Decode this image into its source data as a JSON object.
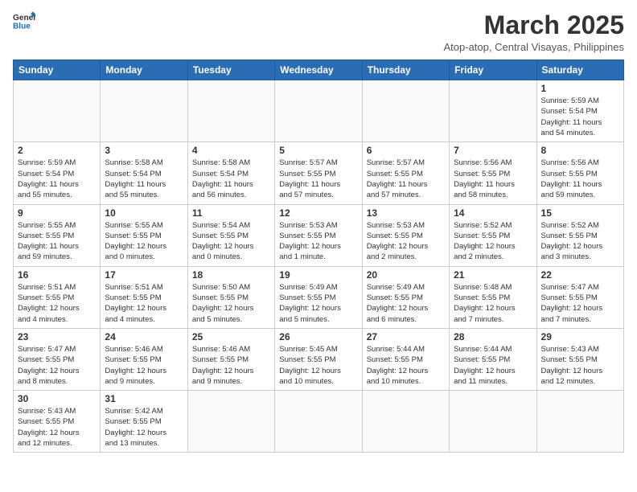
{
  "logo": {
    "line1": "General",
    "line2": "Blue"
  },
  "title": "March 2025",
  "subtitle": "Atop-atop, Central Visayas, Philippines",
  "weekdays": [
    "Sunday",
    "Monday",
    "Tuesday",
    "Wednesday",
    "Thursday",
    "Friday",
    "Saturday"
  ],
  "weeks": [
    [
      {
        "day": "",
        "info": ""
      },
      {
        "day": "",
        "info": ""
      },
      {
        "day": "",
        "info": ""
      },
      {
        "day": "",
        "info": ""
      },
      {
        "day": "",
        "info": ""
      },
      {
        "day": "",
        "info": ""
      },
      {
        "day": "1",
        "info": "Sunrise: 5:59 AM\nSunset: 5:54 PM\nDaylight: 11 hours\nand 54 minutes."
      }
    ],
    [
      {
        "day": "2",
        "info": "Sunrise: 5:59 AM\nSunset: 5:54 PM\nDaylight: 11 hours\nand 55 minutes."
      },
      {
        "day": "3",
        "info": "Sunrise: 5:58 AM\nSunset: 5:54 PM\nDaylight: 11 hours\nand 55 minutes."
      },
      {
        "day": "4",
        "info": "Sunrise: 5:58 AM\nSunset: 5:54 PM\nDaylight: 11 hours\nand 56 minutes."
      },
      {
        "day": "5",
        "info": "Sunrise: 5:57 AM\nSunset: 5:55 PM\nDaylight: 11 hours\nand 57 minutes."
      },
      {
        "day": "6",
        "info": "Sunrise: 5:57 AM\nSunset: 5:55 PM\nDaylight: 11 hours\nand 57 minutes."
      },
      {
        "day": "7",
        "info": "Sunrise: 5:56 AM\nSunset: 5:55 PM\nDaylight: 11 hours\nand 58 minutes."
      },
      {
        "day": "8",
        "info": "Sunrise: 5:56 AM\nSunset: 5:55 PM\nDaylight: 11 hours\nand 59 minutes."
      }
    ],
    [
      {
        "day": "9",
        "info": "Sunrise: 5:55 AM\nSunset: 5:55 PM\nDaylight: 11 hours\nand 59 minutes."
      },
      {
        "day": "10",
        "info": "Sunrise: 5:55 AM\nSunset: 5:55 PM\nDaylight: 12 hours\nand 0 minutes."
      },
      {
        "day": "11",
        "info": "Sunrise: 5:54 AM\nSunset: 5:55 PM\nDaylight: 12 hours\nand 0 minutes."
      },
      {
        "day": "12",
        "info": "Sunrise: 5:53 AM\nSunset: 5:55 PM\nDaylight: 12 hours\nand 1 minute."
      },
      {
        "day": "13",
        "info": "Sunrise: 5:53 AM\nSunset: 5:55 PM\nDaylight: 12 hours\nand 2 minutes."
      },
      {
        "day": "14",
        "info": "Sunrise: 5:52 AM\nSunset: 5:55 PM\nDaylight: 12 hours\nand 2 minutes."
      },
      {
        "day": "15",
        "info": "Sunrise: 5:52 AM\nSunset: 5:55 PM\nDaylight: 12 hours\nand 3 minutes."
      }
    ],
    [
      {
        "day": "16",
        "info": "Sunrise: 5:51 AM\nSunset: 5:55 PM\nDaylight: 12 hours\nand 4 minutes."
      },
      {
        "day": "17",
        "info": "Sunrise: 5:51 AM\nSunset: 5:55 PM\nDaylight: 12 hours\nand 4 minutes."
      },
      {
        "day": "18",
        "info": "Sunrise: 5:50 AM\nSunset: 5:55 PM\nDaylight: 12 hours\nand 5 minutes."
      },
      {
        "day": "19",
        "info": "Sunrise: 5:49 AM\nSunset: 5:55 PM\nDaylight: 12 hours\nand 5 minutes."
      },
      {
        "day": "20",
        "info": "Sunrise: 5:49 AM\nSunset: 5:55 PM\nDaylight: 12 hours\nand 6 minutes."
      },
      {
        "day": "21",
        "info": "Sunrise: 5:48 AM\nSunset: 5:55 PM\nDaylight: 12 hours\nand 7 minutes."
      },
      {
        "day": "22",
        "info": "Sunrise: 5:47 AM\nSunset: 5:55 PM\nDaylight: 12 hours\nand 7 minutes."
      }
    ],
    [
      {
        "day": "23",
        "info": "Sunrise: 5:47 AM\nSunset: 5:55 PM\nDaylight: 12 hours\nand 8 minutes."
      },
      {
        "day": "24",
        "info": "Sunrise: 5:46 AM\nSunset: 5:55 PM\nDaylight: 12 hours\nand 9 minutes."
      },
      {
        "day": "25",
        "info": "Sunrise: 5:46 AM\nSunset: 5:55 PM\nDaylight: 12 hours\nand 9 minutes."
      },
      {
        "day": "26",
        "info": "Sunrise: 5:45 AM\nSunset: 5:55 PM\nDaylight: 12 hours\nand 10 minutes."
      },
      {
        "day": "27",
        "info": "Sunrise: 5:44 AM\nSunset: 5:55 PM\nDaylight: 12 hours\nand 10 minutes."
      },
      {
        "day": "28",
        "info": "Sunrise: 5:44 AM\nSunset: 5:55 PM\nDaylight: 12 hours\nand 11 minutes."
      },
      {
        "day": "29",
        "info": "Sunrise: 5:43 AM\nSunset: 5:55 PM\nDaylight: 12 hours\nand 12 minutes."
      }
    ],
    [
      {
        "day": "30",
        "info": "Sunrise: 5:43 AM\nSunset: 5:55 PM\nDaylight: 12 hours\nand 12 minutes."
      },
      {
        "day": "31",
        "info": "Sunrise: 5:42 AM\nSunset: 5:55 PM\nDaylight: 12 hours\nand 13 minutes."
      },
      {
        "day": "",
        "info": ""
      },
      {
        "day": "",
        "info": ""
      },
      {
        "day": "",
        "info": ""
      },
      {
        "day": "",
        "info": ""
      },
      {
        "day": "",
        "info": ""
      }
    ]
  ]
}
